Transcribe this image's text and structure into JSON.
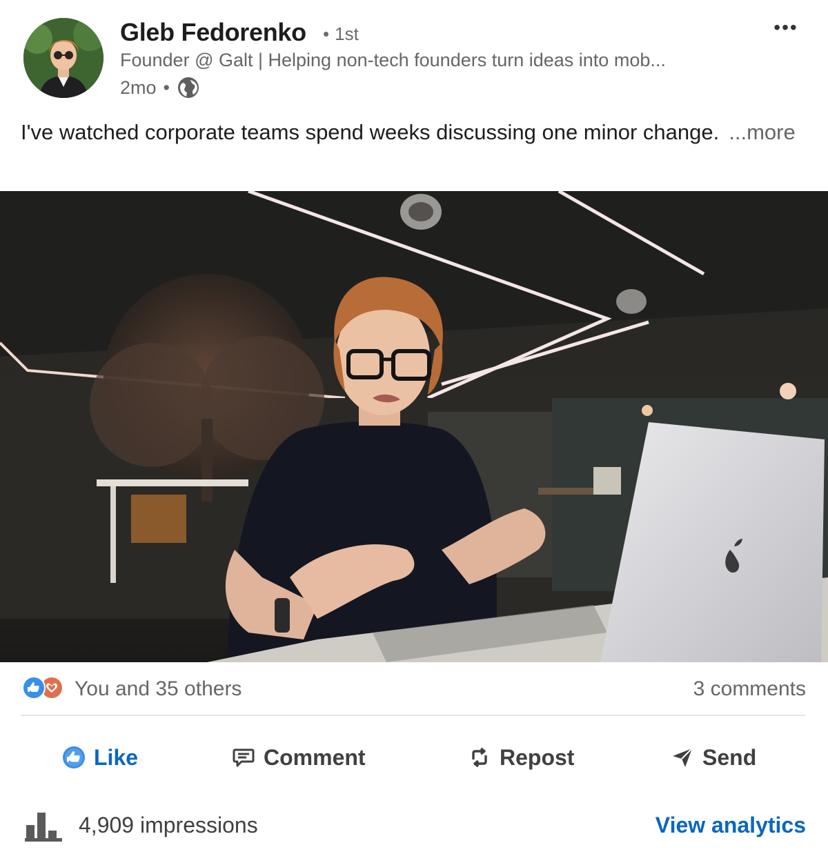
{
  "author": {
    "name": "Gleb Fedorenko",
    "connection_degree": "1st",
    "headline": "Founder @ Galt | Helping non-tech founders turn ideas into mob...",
    "posted_time": "2mo"
  },
  "post": {
    "text": "I've watched corporate teams spend weeks discussing one minor change.",
    "more_label": "...more",
    "media_description_icon": "video-thumbnail"
  },
  "social": {
    "reactions_text": "You and 35 others",
    "comments_text": "3 comments",
    "reaction_icons": [
      "like-icon",
      "love-icon"
    ]
  },
  "actions": {
    "like": "Like",
    "comment": "Comment",
    "repost": "Repost",
    "send": "Send"
  },
  "footer": {
    "impressions_count": "4,909",
    "impressions_label": "impressions",
    "analytics_link": "View analytics"
  },
  "colors": {
    "accent": "#0a66c2",
    "like_reaction": "#378fe9",
    "love_reaction": "#df704d",
    "muted_text": "#666666"
  }
}
